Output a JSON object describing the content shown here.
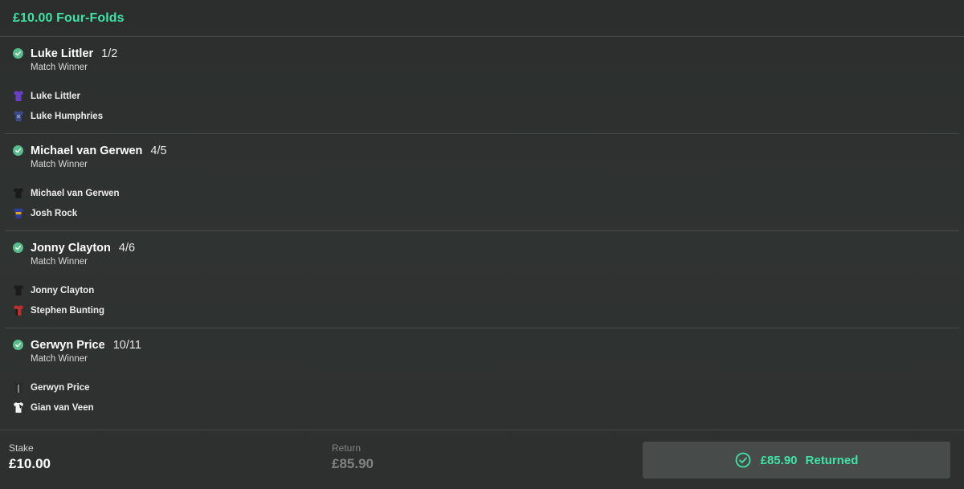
{
  "header": {
    "title": "£10.00 Four-Folds"
  },
  "colors": {
    "accent": "#3fe3a7",
    "check": "#58bd8b",
    "background": "#2d302f"
  },
  "selections": [
    {
      "name": "Luke Littler",
      "odds": "1/2",
      "market": "Match Winner",
      "participants": [
        {
          "name": "Luke Littler",
          "icon": "shirt-icon",
          "color": "#6a3fc4"
        },
        {
          "name": "Luke Humphries",
          "icon": "shirt-icon",
          "color": "#3a4a8c"
        }
      ]
    },
    {
      "name": "Michael van Gerwen",
      "odds": "4/5",
      "market": "Match Winner",
      "participants": [
        {
          "name": "Michael van Gerwen",
          "icon": "shirt-icon",
          "color": "#1b1b1b"
        },
        {
          "name": "Josh Rock",
          "icon": "shirt-icon",
          "color": "#2c3e9a"
        }
      ]
    },
    {
      "name": "Jonny Clayton",
      "odds": "4/6",
      "market": "Match Winner",
      "participants": [
        {
          "name": "Jonny Clayton",
          "icon": "shirt-icon",
          "color": "#1b1b1b"
        },
        {
          "name": "Stephen Bunting",
          "icon": "shirt-icon",
          "color": "#b8302a"
        }
      ]
    },
    {
      "name": "Gerwyn Price",
      "odds": "10/11",
      "market": "Match Winner",
      "participants": [
        {
          "name": "Gerwyn Price",
          "icon": "shirt-icon",
          "color": "#2a2a2a"
        },
        {
          "name": "Gian van Veen",
          "icon": "shirt-icon",
          "color": "#f2f2f2"
        }
      ]
    }
  ],
  "footer": {
    "stake_label": "Stake",
    "stake_value": "£10.00",
    "return_label": "Return",
    "return_value": "£85.90",
    "returned_amount": "£85.90",
    "returned_label": "Returned"
  }
}
